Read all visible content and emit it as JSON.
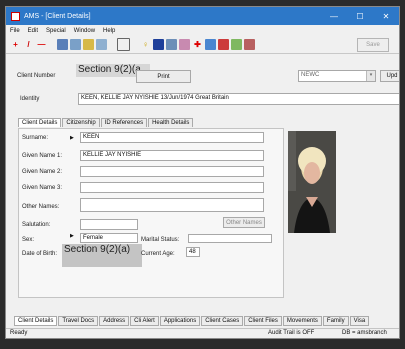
{
  "window": {
    "title": "AMS - [Client Details]",
    "minimize": "—",
    "maximize": "☐",
    "close": "✕"
  },
  "menu": [
    "File",
    "Edit",
    "Special",
    "Window",
    "Help"
  ],
  "toolbar": {
    "save_label": "Save"
  },
  "header": {
    "client_number_label": "Client Number",
    "client_number_redaction": "Section 9(2)(a",
    "print_button": "Print",
    "office_value": "NEWC",
    "update_button": "Upd",
    "identity_label": "Identity",
    "identity_value": "KEEN, KELLIE JAY NYISHIE   13/Jun/1974   Great Britain"
  },
  "subtabs": [
    "Client Details",
    "Citizenship",
    "ID References",
    "Health Details"
  ],
  "form": {
    "surname_label": "Surname:",
    "surname_value": "KEEN",
    "given1_label": "Given Name 1:",
    "given1_value": "KELLIE JAY NYISHIE",
    "given2_label": "Given Name 2:",
    "given3_label": "Given Name 3:",
    "other_names_label": "Other Names:",
    "salutation_label": "Salutation:",
    "other_names_button": "Other Names",
    "sex_label": "Sex:",
    "sex_value": "Female",
    "marital_label": "Marital Status:",
    "dob_label": "Date of Birth:",
    "dob_redaction": "Section 9(2)(a)",
    "current_age_label": "Current Age:",
    "current_age_value": "48"
  },
  "bottom_tabs": [
    "Client Details",
    "Travel Docs",
    "Address",
    "Cli Alert",
    "Applications",
    "Client Cases",
    "Client Files",
    "Movements",
    "Family",
    "Visa"
  ],
  "status": {
    "left": "Ready",
    "audit": "Audit Trail is OFF",
    "db": "DB = amsbranch"
  }
}
